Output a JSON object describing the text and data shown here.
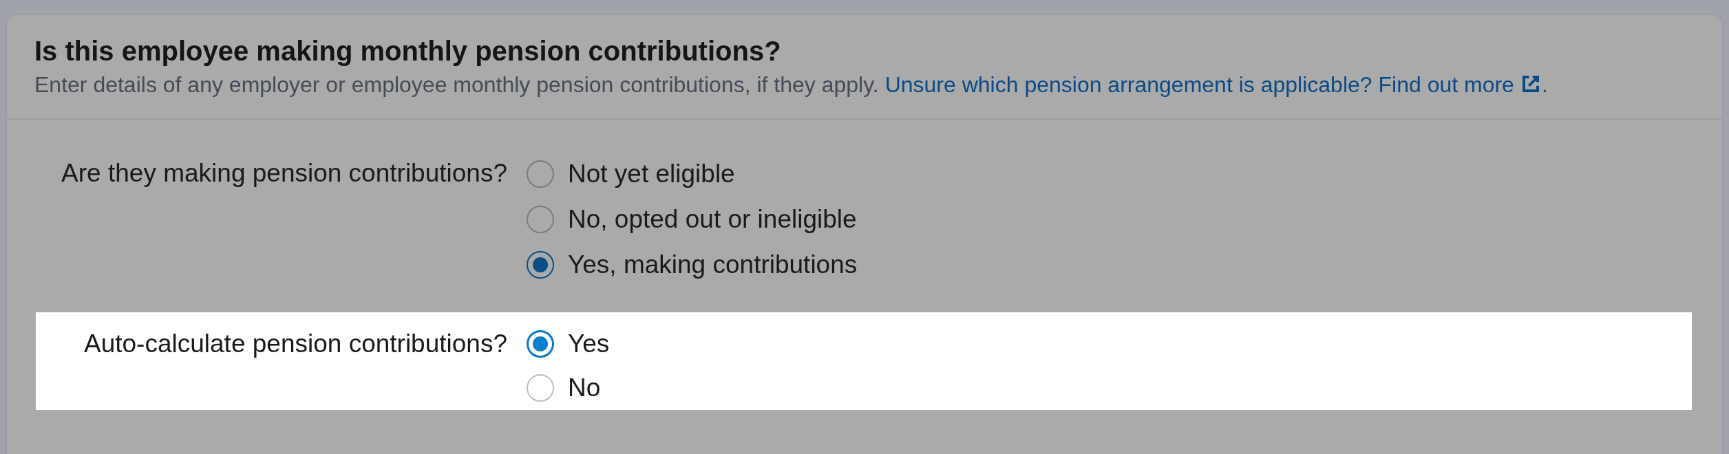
{
  "card": {
    "title": "Is this employee making monthly pension contributions?",
    "subtitle": {
      "text": "Enter details of any employer or employee monthly pension contributions, if they apply. ",
      "link": "Unsure which pension arrangement is applicable? Find out more",
      "trailing": "."
    }
  },
  "groups": [
    {
      "question": "Are they making pension contributions?",
      "highlighted": false,
      "options": [
        {
          "label": "Not yet eligible",
          "selected": false
        },
        {
          "label": "No, opted out or ineligible",
          "selected": false
        },
        {
          "label": "Yes, making contributions",
          "selected": true
        }
      ]
    },
    {
      "question": "Auto-calculate pension contributions?",
      "highlighted": true,
      "options": [
        {
          "label": "Yes",
          "selected": true
        },
        {
          "label": "No",
          "selected": false
        }
      ]
    }
  ]
}
